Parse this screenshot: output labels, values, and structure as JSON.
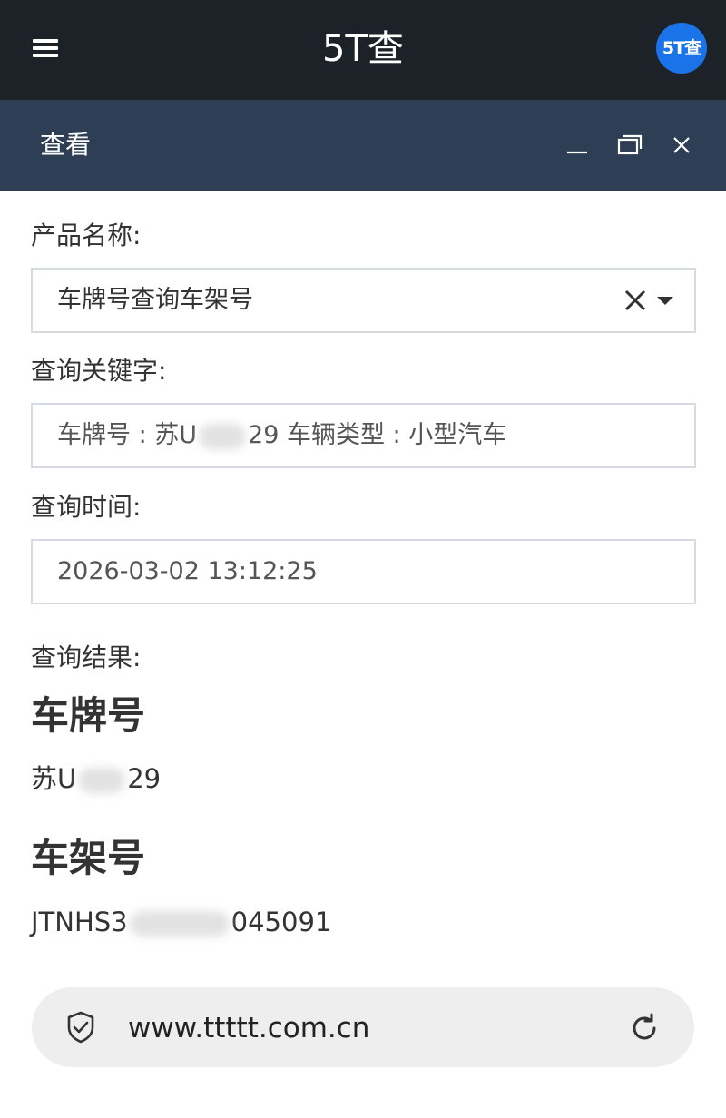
{
  "app": {
    "title": "5T查",
    "logo_text": "5T查"
  },
  "icons": {
    "menu": "hamburger-menu-icon",
    "minimize": "minimize-icon",
    "maximize": "maximize-icon",
    "close": "close-icon",
    "clear": "clear-x-icon",
    "dropdown": "caret-down-icon",
    "security": "shield-check-icon",
    "reload": "refresh-icon"
  },
  "colors": {
    "topbar": "#1d2229",
    "dialog_header": "#2e3f55",
    "logo_bg": "#1a73e8",
    "field_border": "#d5dbe0",
    "urlbar_bg": "#eeeeee"
  },
  "dialog": {
    "title": "查看"
  },
  "form": {
    "product_label": "产品名称:",
    "product_value": "车牌号查询车架号",
    "keyword_label": "查询关键字:",
    "keyword_prefix": "车牌号 : 苏U",
    "keyword_suffix": "29  车辆类型 : 小型汽车",
    "time_label": "查询时间:",
    "time_value": "2026-03-02 13:12:25",
    "result_label": "查询结果:"
  },
  "result": {
    "plate_title": "车牌号",
    "plate_prefix": "苏U",
    "plate_suffix": "29",
    "vin_title": "车架号",
    "vin_prefix": "JTNHS3",
    "vin_suffix": "045091"
  },
  "browser": {
    "url": "www.ttttt.com.cn"
  }
}
